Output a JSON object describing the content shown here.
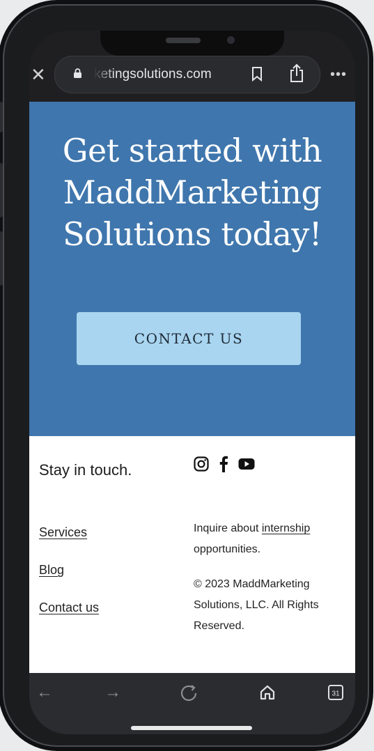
{
  "browser": {
    "url": "ketingsolutions.com",
    "close_glyph": "✕",
    "more_glyph": "•••"
  },
  "hero": {
    "title_line1": "Get started with",
    "title_line2": "MaddMarketing",
    "title_line3": "Solutions today!",
    "cta_label": "CONTACT US"
  },
  "footer": {
    "stay_in_touch": "Stay in touch.",
    "links": [
      "Services",
      "Blog",
      "Contact us"
    ],
    "inquire_prefix": "Inquire about ",
    "inquire_link": "internship",
    "inquire_suffix": "opportunities.",
    "copyright_line1": "© 2023 MaddMarketing",
    "copyright_line2": "Solutions, LLC. All Rights",
    "copyright_line3": "Reserved."
  },
  "bottom_nav": {
    "back_glyph": "←",
    "forward_glyph": "→",
    "tabs_count": "31"
  },
  "icons": [
    "lock-icon",
    "bookmark-icon",
    "share-icon",
    "instagram-icon",
    "facebook-icon",
    "youtube-icon",
    "home-icon",
    "tabs-icon",
    "reload-icon"
  ],
  "colors": {
    "hero_bg": "#3f76ad",
    "cta_bg": "#a9d5f0"
  }
}
